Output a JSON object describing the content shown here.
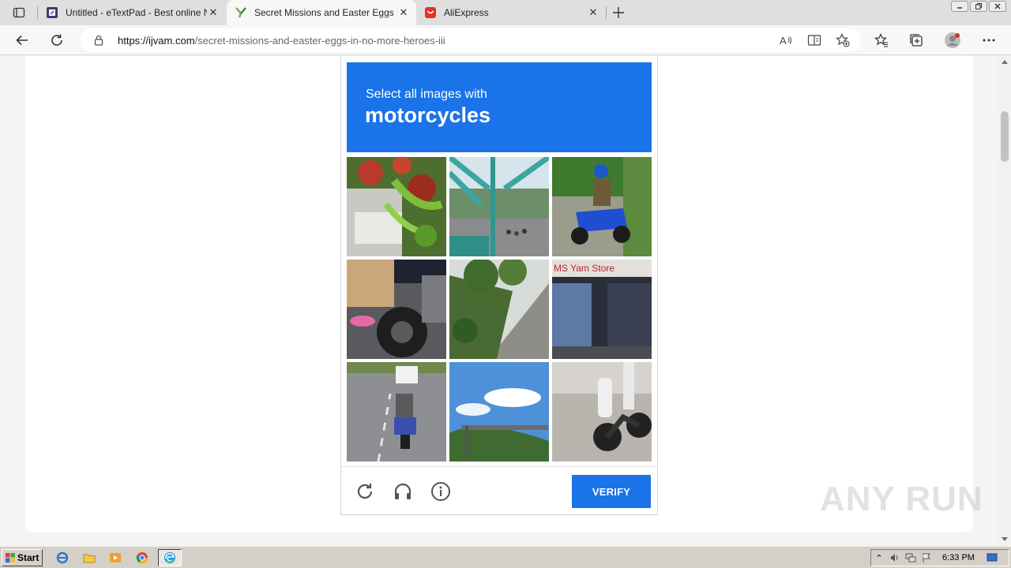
{
  "browser": {
    "tabs": [
      {
        "title": "Untitled - eTextPad - Best online Notepad",
        "active": false,
        "favicon": "etextpad-icon"
      },
      {
        "title": "Secret Missions and Easter Eggs in No More Heroes III",
        "active": true,
        "favicon": "ijvam-icon"
      },
      {
        "title": "AliExpress",
        "active": false,
        "favicon": "aliexpress-icon"
      }
    ],
    "url_host": "https://ijvam.com",
    "url_path": "/secret-missions-and-easter-eggs-in-no-more-heroes-iii"
  },
  "captcha": {
    "instruction": "Select all images with",
    "target": "motorcycles",
    "verify_label": "VERIFY",
    "tiles": [
      {
        "subject": "red flowers and car"
      },
      {
        "subject": "bridge with pedestrians"
      },
      {
        "subject": "rider on blue scooter"
      },
      {
        "subject": "close-up of motorcycle wheel"
      },
      {
        "subject": "roadside vegetation"
      },
      {
        "subject": "store front",
        "sign_text": "MS Yam Store"
      },
      {
        "subject": "motorcyclist on highway"
      },
      {
        "subject": "sky and overpass"
      },
      {
        "subject": "parked motorcycle by curb"
      }
    ]
  },
  "watermark": "ANY RUN",
  "taskbar": {
    "start_label": "Start",
    "clock": "6:33 PM"
  },
  "colors": {
    "accent": "#1a73e8"
  }
}
